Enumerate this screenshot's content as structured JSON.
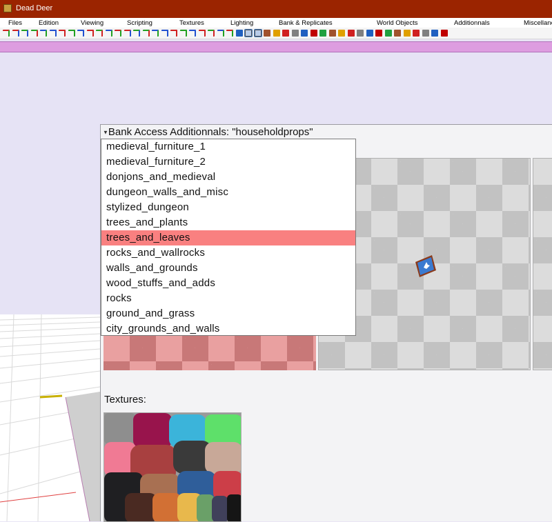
{
  "window": {
    "title": "Dead Deer"
  },
  "menu": [
    "Files",
    "Edition",
    "Viewing",
    "Scripting",
    "Textures",
    "Lighting",
    "Bank & Replicates",
    "World Objects",
    "Additionnals",
    "Miscellaneous"
  ],
  "toolbar_icons": [
    "arrow-icon",
    "arrow-icon",
    "arrow-icon",
    "arrow-icon",
    "arrow-icon",
    "arrow-icon",
    "arrow-icon",
    "arrow-icon",
    "arrow-icon",
    "arrow-icon",
    "arrow-icon",
    "arrow-icon",
    "arrow-icon",
    "arrow-icon",
    "arrow-icon",
    "arrow-icon",
    "arrow-icon",
    "arrow-icon",
    "arrow-icon",
    "arrow-icon",
    "arrow-icon",
    "arrow-icon",
    "arrow-icon",
    "arrow-icon",
    "arrow-icon",
    "select-icon",
    "select-icon",
    "box-icon",
    "box-icon",
    "box-icon",
    "box-icon",
    "box-icon",
    "box-icon",
    "box-icon",
    "box-icon",
    "box-icon",
    "box-icon",
    "box-icon",
    "box-icon",
    "box-icon",
    "box-icon",
    "box-icon",
    "box-icon",
    "box-icon",
    "box-icon",
    "box-icon",
    "box-icon",
    "box-icon"
  ],
  "panel": {
    "header": "Bank Access Additionnals: \"householdprops\"",
    "textures_label": "Textures:"
  },
  "dropdown": {
    "items": [
      "medieval_furniture_1",
      "medieval_furniture_2",
      "donjons_and_medieval",
      "dungeon_walls_and_misc",
      "stylized_dungeon",
      "trees_and_plants",
      "trees_and_leaves",
      "rocks_and_wallrocks",
      "walls_and_grounds",
      "wood_stuffs_and_adds",
      "rocks",
      "ground_and_grass",
      "city_grounds_and_walls"
    ],
    "highlighted": "trees_and_leaves"
  },
  "colors": {
    "title_bar": "#9b2400",
    "highlight": "#f98080",
    "pink_bar": "#dd9de0"
  }
}
